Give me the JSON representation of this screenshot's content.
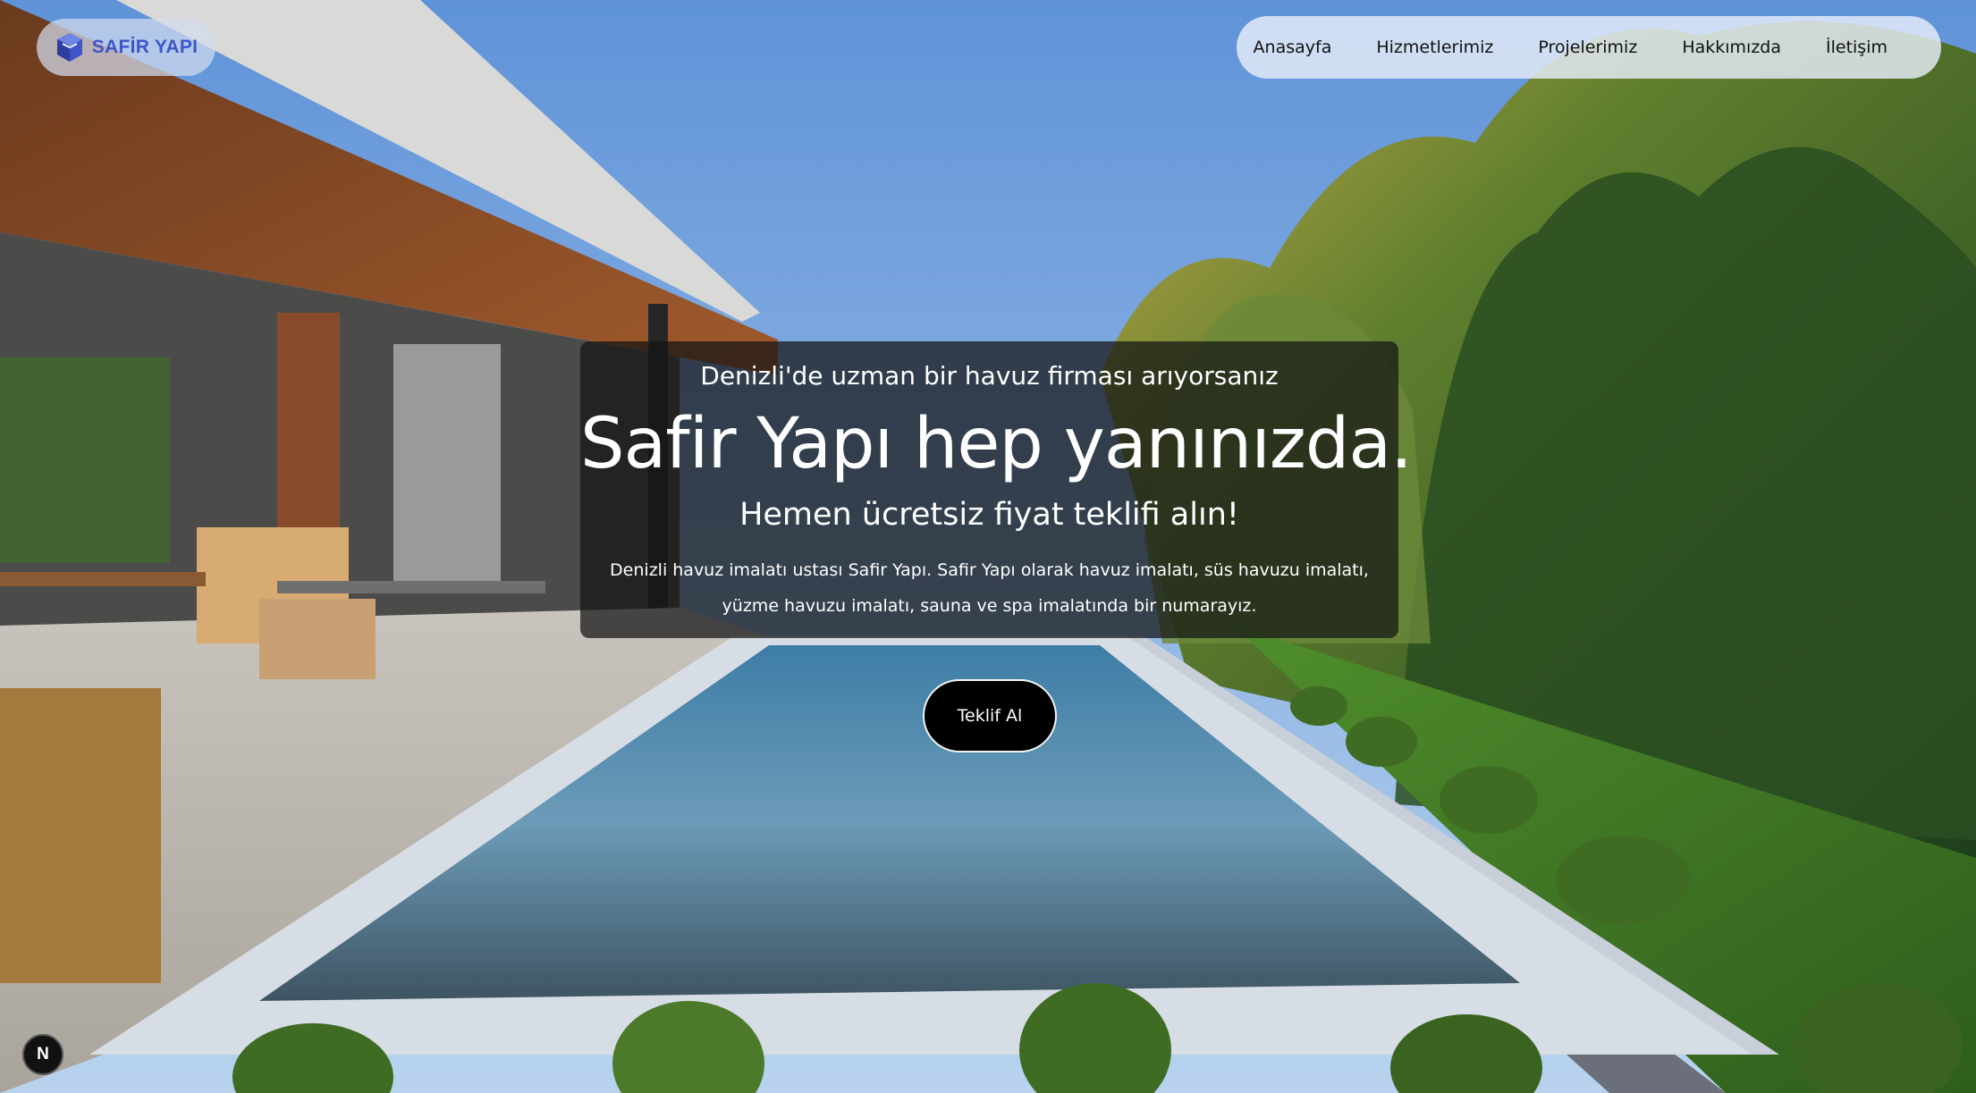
{
  "brand": {
    "logo_text": "SAFİR YAPI",
    "accent_color": "#3d55c9"
  },
  "nav": {
    "items": [
      {
        "label": "Anasayfa"
      },
      {
        "label": "Hizmetlerimiz"
      },
      {
        "label": "Projelerimiz"
      },
      {
        "label": "Hakkımızda"
      },
      {
        "label": "İletişim"
      }
    ]
  },
  "hero": {
    "kicker": "Denizli'de uzman bir havuz firması arıyorsanız",
    "title": "Safir Yapı hep yanınızda.",
    "subtitle": "Hemen ücretsiz fiyat teklifi alın!",
    "description": "Denizli havuz imalatı ustası Safir Yapı. Safir Yapı olarak havuz imalatı, süs havuzu imalatı, yüzme havuzu imalatı, sauna ve spa imalatında bir numarayız.",
    "cta_label": "Teklif Al",
    "background": "pool-villa-photo"
  },
  "dev_badge": {
    "label": "N",
    "icon": "nextjs-icon"
  }
}
